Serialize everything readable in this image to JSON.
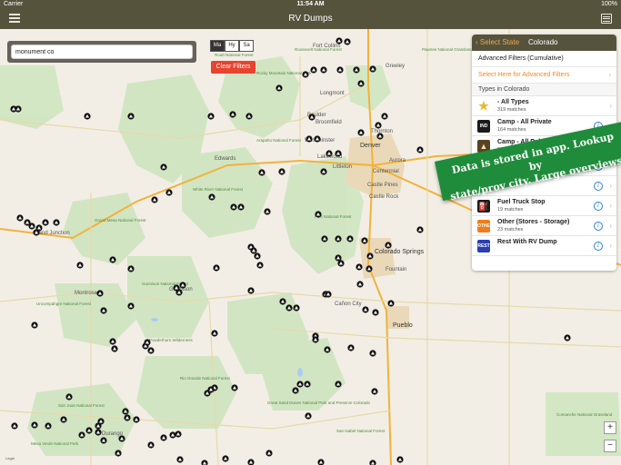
{
  "status": {
    "carrier": "Carrier",
    "time": "11:54 AM",
    "battery": "100%"
  },
  "navbar": {
    "title": "RV Dumps"
  },
  "search": {
    "value": "monument co"
  },
  "map_type": {
    "options": [
      "Ma",
      "Hy",
      "Sa"
    ],
    "selected": "Ma"
  },
  "clear_filters": "Clear Filters",
  "panel": {
    "back_label": "Select State",
    "state": "Colorado",
    "advanced_title": "Advanced Filters (Cumulative)",
    "advanced_link": "Select Here for Advanced Filters",
    "section_title": "Types in Colorado",
    "items": [
      {
        "icon": "star-icon",
        "icon_text": "",
        "color": "#ffffff",
        "name": "- All Types",
        "sub": "319 matches"
      },
      {
        "icon": "ind-icon",
        "icon_text": "IND",
        "color": "#1b1b1b",
        "name": "Camp - All Private",
        "sub": "164 matches"
      },
      {
        "icon": "tent-icon",
        "icon_text": "",
        "color": "#5a4323",
        "name": "Camp - All Public/Govt",
        "sub": "84 matches"
      },
      {
        "icon": "cnp-icon",
        "icon_text": "CNP",
        "color": "#6a2fa8",
        "name": "Camp - Lodge Rest.",
        "sub": "1 match"
      },
      {
        "icon": "blank-icon",
        "icon_text": "",
        "color": "#ffffff",
        "name": "",
        "sub": ""
      },
      {
        "icon": "fuel-icon",
        "icon_text": "",
        "color": "#1b1b1b",
        "name": "Fuel Truck Stop",
        "sub": "19 matches"
      },
      {
        "icon": "other-icon",
        "icon_text": "OTHER",
        "color": "#f07d1a",
        "name": "Other (Stores - Storage)",
        "sub": "23 matches"
      },
      {
        "icon": "rest-icon",
        "icon_text": "REST",
        "color": "#2a3fb0",
        "name": "Rest With RV Dump",
        "sub": ""
      }
    ]
  },
  "banner": {
    "line1": "Data is stored in app. Lookup by",
    "line2": "state/prov city. Large overviews."
  },
  "zoom": {
    "in": "+",
    "out": "−"
  },
  "legal": "Legal",
  "map_labels": [
    "Fort Collins",
    "Greeley",
    "Longmont",
    "Boulder",
    "Broomfield",
    "Thornton",
    "Westminster",
    "Denver",
    "Lakewood",
    "Aurora",
    "Littleton",
    "Centennial",
    "Castle Pines",
    "Castle Rock",
    "Colorado Springs",
    "Fountain",
    "Pueblo",
    "Cañon City",
    "Edwards",
    "Grand Junction",
    "Montrose",
    "Gunnison",
    "Durango",
    "Mesa Verde National Park",
    "Rocky Mountain National Park",
    "Great Sand Dunes National Park and Preserve Colorado",
    "Pike National Forest",
    "White River National Forest",
    "Arapaho National Forest",
    "Rio Grande National Forest",
    "San Juan National Forest",
    "Grand Mesa National Forest",
    "Uncompahgre National Forest",
    "Gunnison National Forest",
    "Routt National Forest",
    "Roosevelt National Forest",
    "Comanche National Grassland",
    "Pawnee National Grassland",
    "San Isabel National Forest",
    "Powderhorn Wilderness"
  ]
}
